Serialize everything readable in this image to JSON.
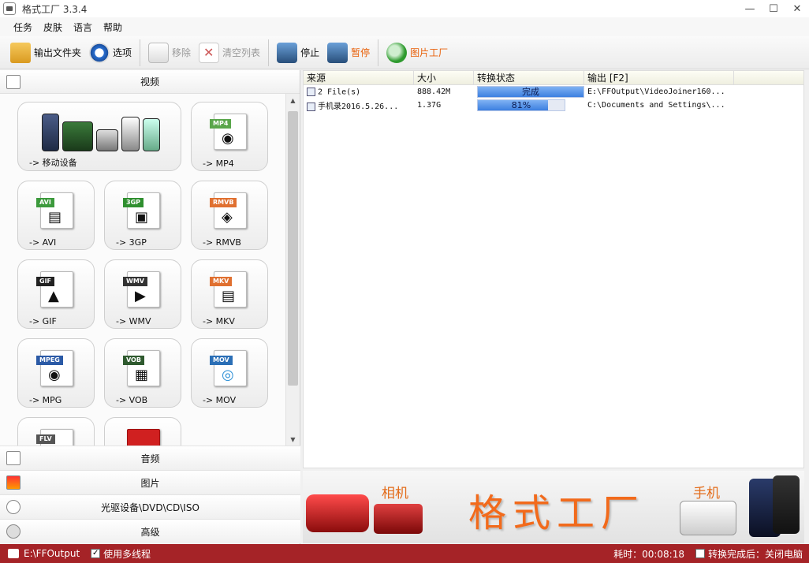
{
  "window": {
    "title": "格式工厂 3.3.4",
    "min": "—",
    "max": "☐",
    "close": "✕"
  },
  "menu": [
    "任务",
    "皮肤",
    "语言",
    "帮助"
  ],
  "toolbar": {
    "output_folder": "输出文件夹",
    "options": "选项",
    "remove": "移除",
    "clear_list": "清空列表",
    "stop": "停止",
    "pause": "暂停",
    "picture_factory": "图片工厂"
  },
  "left": {
    "video_header": "视频",
    "tiles": [
      {
        "label": "-> 移动设备",
        "tag": ""
      },
      {
        "label": "-> MP4",
        "tag": "MP4",
        "color": "#5aa64b"
      },
      {
        "label": "-> AVI",
        "tag": "AVI",
        "color": "#3c9a3c"
      },
      {
        "label": "-> 3GP",
        "tag": "3GP",
        "color": "#2f8f2f"
      },
      {
        "label": "-> RMVB",
        "tag": "RMVB",
        "color": "#e07030"
      },
      {
        "label": "-> GIF",
        "tag": "GIF",
        "color": "#222222"
      },
      {
        "label": "-> WMV",
        "tag": "WMV",
        "color": "#333333"
      },
      {
        "label": "-> MKV",
        "tag": "MKV",
        "color": "#e07030"
      },
      {
        "label": "-> MPG",
        "tag": "MPEG",
        "color": "#2b5aa6"
      },
      {
        "label": "-> VOB",
        "tag": "VOB",
        "color": "#2f5a2f"
      },
      {
        "label": "-> MOV",
        "tag": "MOV",
        "color": "#2b6fb6"
      },
      {
        "label": "",
        "tag": "FLV",
        "color": "#555555"
      },
      {
        "label": "",
        "tag": "",
        "color": "#d02020"
      }
    ],
    "categories": [
      "音频",
      "图片",
      "光驱设备\\DVD\\CD\\ISO",
      "高级"
    ]
  },
  "table": {
    "headers": [
      "来源",
      "大小",
      "转换状态",
      "输出 [F2]"
    ],
    "rows": [
      {
        "source": "2 File(s)",
        "size": "888.42M",
        "status": "完成",
        "progress": 1.0,
        "output": "E:\\FFOutput\\VideoJoiner160..."
      },
      {
        "source": "手机录2016.5.26...",
        "size": "1.37G",
        "status": "81%",
        "progress": 0.81,
        "output": "C:\\Documents and Settings\\..."
      }
    ]
  },
  "banner": {
    "camera": "相机",
    "title": "格式工厂",
    "phone": "手机"
  },
  "status": {
    "path": "E:\\FFOutput",
    "multithread": "使用多线程",
    "elapsed": "耗时：00:08:18",
    "after_done": "转换完成后：关闭电脑"
  }
}
